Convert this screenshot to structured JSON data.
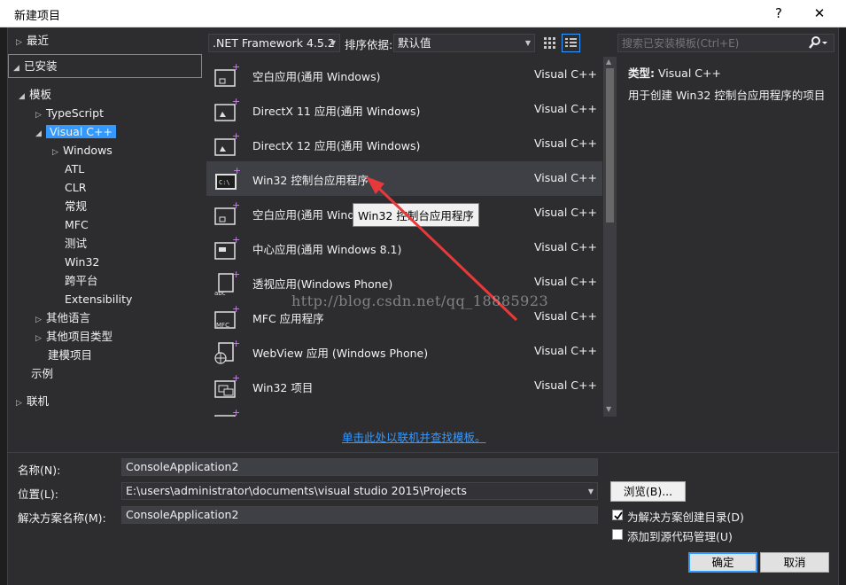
{
  "window": {
    "title": "新建项目",
    "help_label": "?",
    "close_label": "✕"
  },
  "tree": {
    "recent": "最近",
    "installed": "已安装",
    "templates": "模板",
    "typescript": "TypeScript",
    "visual_cpp": "Visual C++",
    "windows": "Windows",
    "atl": "ATL",
    "clr": "CLR",
    "general": "常规",
    "mfc": "MFC",
    "test": "测试",
    "win32": "Win32",
    "cross_platform": "跨平台",
    "extensibility": "Extensibility",
    "other_languages": "其他语言",
    "other_project_types": "其他项目类型",
    "modeling_projects": "建模项目",
    "samples": "示例",
    "online": "联机"
  },
  "toolbar": {
    "framework": ".NET Framework 4.5.2",
    "sort_label": "排序依据:",
    "sort_value": "默认值",
    "search_placeholder": "搜索已安装模板(Ctrl+E)"
  },
  "templates": [
    {
      "name": "空白应用(通用 Windows)",
      "lang": "Visual C++",
      "icon": "blank-app-icon"
    },
    {
      "name": "DirectX 11 应用(通用 Windows)",
      "lang": "Visual C++",
      "icon": "directx-app-icon"
    },
    {
      "name": "DirectX 12 应用(通用 Windows)",
      "lang": "Visual C++",
      "icon": "directx-app-icon"
    },
    {
      "name": "Win32 控制台应用程序",
      "lang": "Visual C++",
      "icon": "console-app-icon"
    },
    {
      "name": "空白应用(通用 Windows 8.1)",
      "lang": "Visual C++",
      "icon": "blank-app-icon"
    },
    {
      "name": "中心应用(通用 Windows 8.1)",
      "lang": "Visual C++",
      "icon": "hub-app-icon"
    },
    {
      "name": "透视应用(Windows Phone)",
      "lang": "Visual C++",
      "icon": "pivot-app-icon"
    },
    {
      "name": "MFC 应用程序",
      "lang": "Visual C++",
      "icon": "mfc-app-icon"
    },
    {
      "name": "WebView 应用 (Windows Phone)",
      "lang": "Visual C++",
      "icon": "webview-app-icon"
    },
    {
      "name": "Win32 项目",
      "lang": "Visual C++",
      "icon": "win32-project-icon"
    },
    {
      "name": "",
      "lang": "",
      "icon": "partial-item-icon"
    }
  ],
  "tooltip": "Win32 控制台应用程序",
  "watermark": "http://blog.csdn.net/qq_18885923",
  "description": {
    "type_label": "类型:",
    "type_value": "Visual C++",
    "text": "用于创建 Win32 控制台应用程序的项目"
  },
  "online_link": "单击此处以联机并查找模板。",
  "form": {
    "name_label": "名称(N):",
    "name_value": "ConsoleApplication2",
    "location_label": "位置(L):",
    "location_value": "E:\\users\\administrator\\documents\\visual studio 2015\\Projects",
    "solution_label": "解决方案名称(M):",
    "solution_value": "ConsoleApplication2",
    "browse_label": "浏览(B)...",
    "create_dir_label": "为解决方案创建目录(D)",
    "create_dir_checked": true,
    "add_source_label": "添加到源代码管理(U)",
    "add_source_checked": false
  },
  "buttons": {
    "ok": "确定",
    "cancel": "取消"
  },
  "colors": {
    "accent": "#3399ff",
    "background": "#2d2d30",
    "selected_row": "#3f3f46",
    "arrow": "#e8393a"
  }
}
